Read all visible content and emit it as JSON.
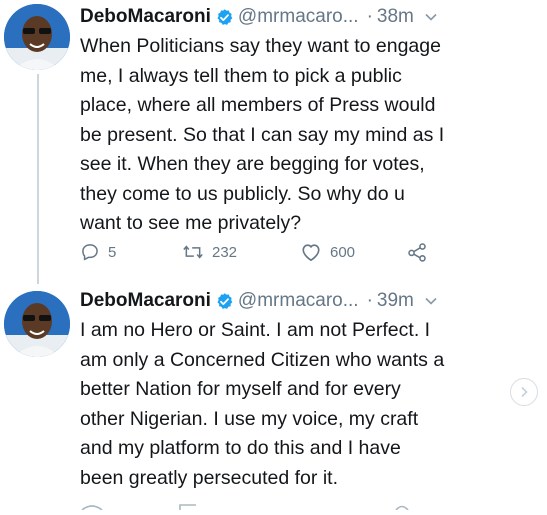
{
  "tweets": [
    {
      "name": "DeboMacaroni",
      "handle": "@mrmacaro...",
      "separator": "·",
      "time": "38m",
      "text": "When Politicians say they want to engage\nme, I always tell them to pick a public\nplace, where all members of Press would\nbe present. So that I can say my mind as I\nsee it. When they are begging for votes,\nthey come to us publicly. So why do u\nwant to see me privately?",
      "replies": "5",
      "retweets": "232",
      "likes": "600"
    },
    {
      "name": "DeboMacaroni",
      "handle": "@mrmacaro...",
      "separator": "·",
      "time": "39m",
      "text": "I am no Hero or Saint. I am not Perfect. I\nam only a Concerned Citizen who wants a\nbetter Nation for myself and for every\nother Nigerian. I use my voice, my craft\nand my platform to do this and I have\nbeen greatly persecuted for it."
    }
  ],
  "colors": {
    "verified": "#1da1f2",
    "secondary_text": "#657786",
    "avatar_bg": "#2b6fbf"
  },
  "icons": [
    "verified-badge-icon",
    "chevron-down-icon",
    "reply-icon",
    "retweet-icon",
    "like-icon",
    "share-icon",
    "chevron-right-icon"
  ]
}
